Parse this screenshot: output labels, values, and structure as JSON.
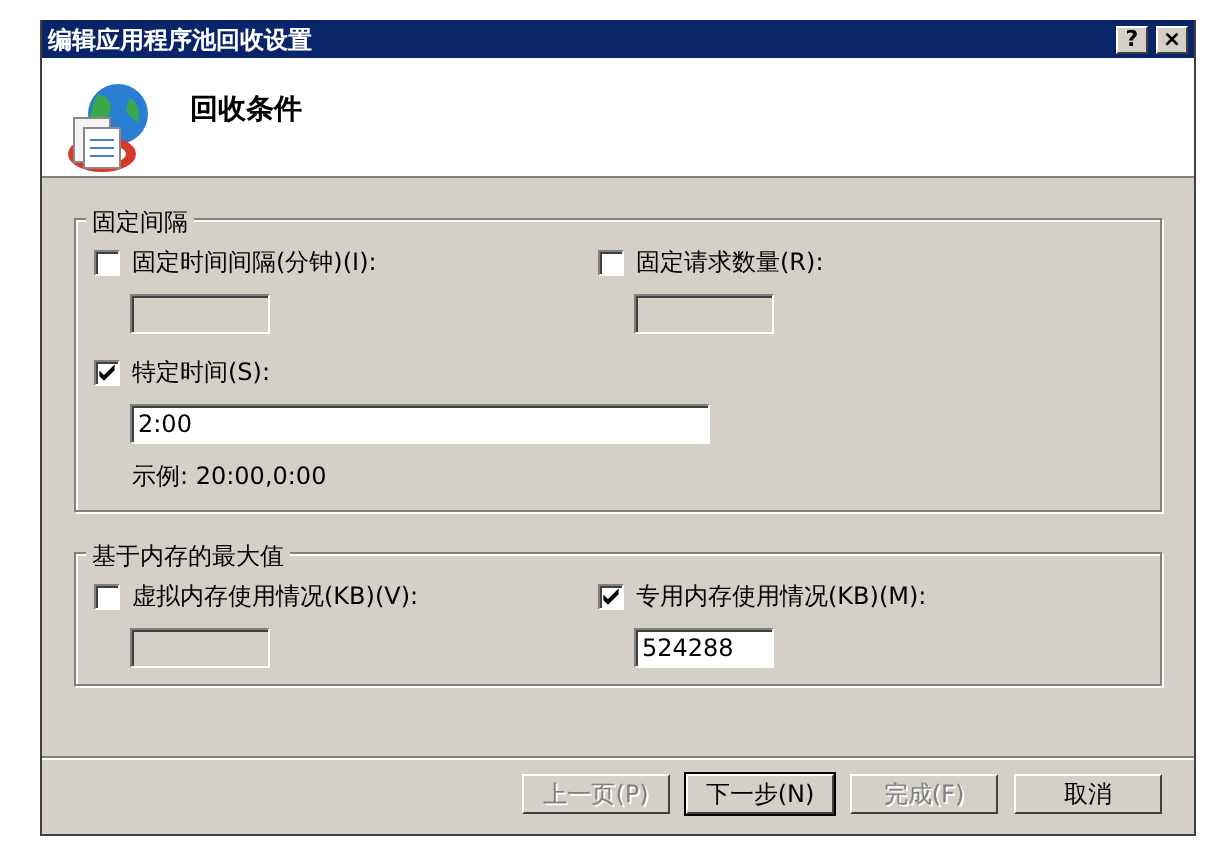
{
  "window": {
    "title": "编辑应用程序池回收设置",
    "title_buttons": [
      "?",
      "×"
    ]
  },
  "header": {
    "title": "回收条件"
  },
  "groups": [
    {
      "title": "固定间隔",
      "fields": [
        {
          "kind": "half",
          "label": "固定时间间隔(分钟)(I):",
          "checked": false
        },
        {
          "kind": "half",
          "label": "固定请求数量(R):",
          "checked": false
        },
        {
          "kind": "wide",
          "label": "特定时间(S):",
          "checked": true,
          "value": "2:00",
          "hint": "示例: 20:00,0:00"
        }
      ]
    },
    {
      "title": "基于内存的最大值",
      "fields": [
        {
          "kind": "half",
          "label": "虚拟内存使用情况(KB)(V):",
          "checked": false
        },
        {
          "kind": "half",
          "label": "专用内存使用情况(KB)(M):",
          "checked": true,
          "value": "524288"
        }
      ]
    }
  ],
  "buttons": [
    {
      "label": "上一页(P)",
      "disabled": true,
      "default": false
    },
    {
      "label": "下一步(N)",
      "disabled": false,
      "default": true
    },
    {
      "label": "完成(F)",
      "disabled": true,
      "default": false
    },
    {
      "label": "取消",
      "disabled": false,
      "default": false
    }
  ]
}
